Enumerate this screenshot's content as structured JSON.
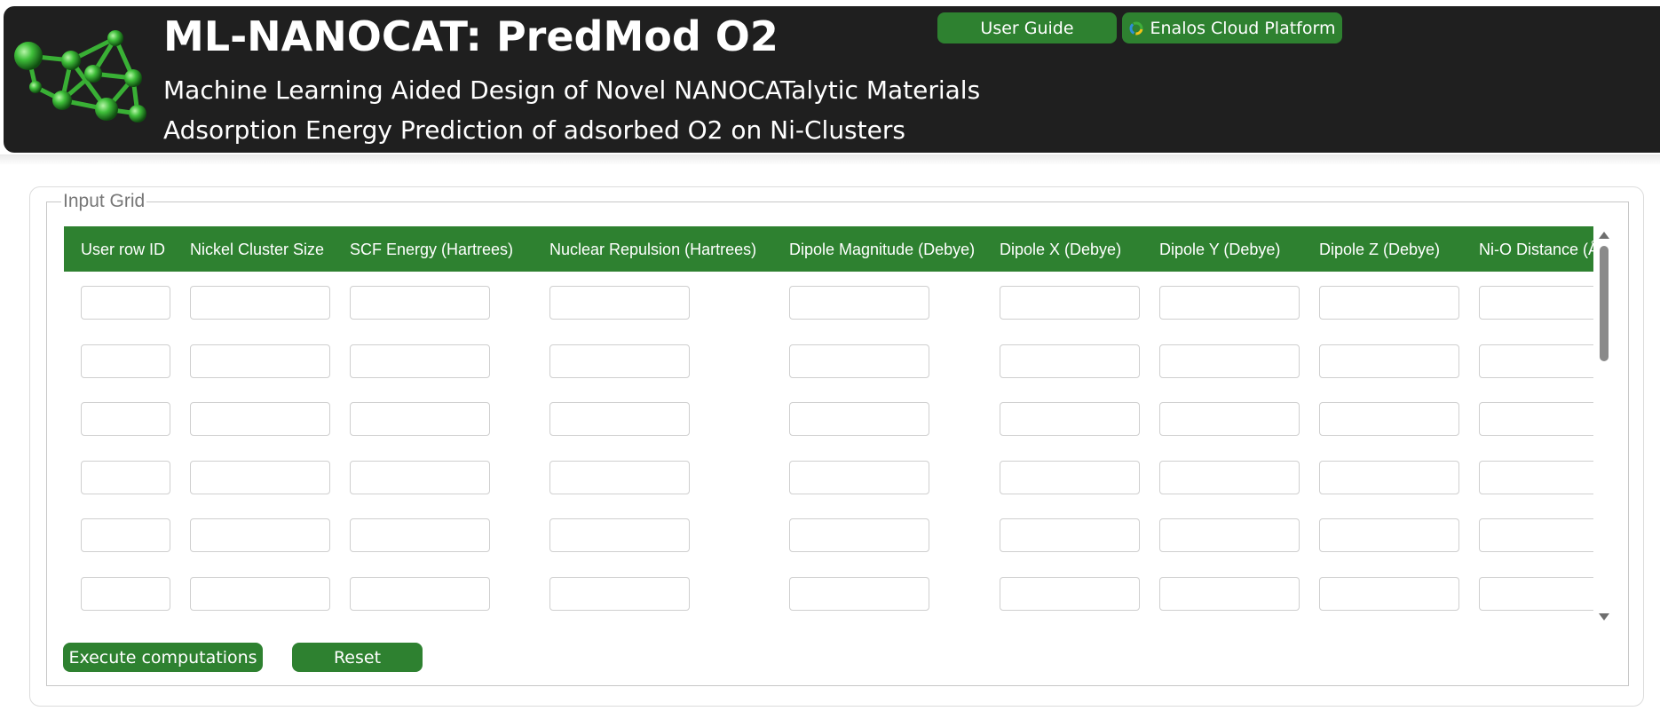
{
  "header": {
    "title": "ML-NANOCAT: PredMod O2",
    "subtitle": "Machine Learning Aided Design of Novel NANOCATalytic Materials",
    "subtitle2": "Adsorption Energy Prediction of adsorbed O2 on Ni-Clusters",
    "buttons": {
      "user_guide": "User Guide",
      "enalos": "Enalos Cloud Platform"
    },
    "logo_icon": "molecule-cluster-icon",
    "enalos_icon": "enalos-logo-icon"
  },
  "grid": {
    "legend": "Input Grid",
    "columns": [
      "User row ID",
      "Nickel Cluster Size",
      "SCF Energy (Hartrees)",
      "Nuclear Repulsion (Hartrees)",
      "Dipole Magnitude (Debye)",
      "Dipole X (Debye)",
      "Dipole Y (Debye)",
      "Dipole Z (Debye)",
      "Ni-O Distance (Å)"
    ],
    "rows": [
      [
        "",
        "",
        "",
        "",
        "",
        "",
        "",
        "",
        ""
      ],
      [
        "",
        "",
        "",
        "",
        "",
        "",
        "",
        "",
        ""
      ],
      [
        "",
        "",
        "",
        "",
        "",
        "",
        "",
        "",
        ""
      ],
      [
        "",
        "",
        "",
        "",
        "",
        "",
        "",
        "",
        ""
      ],
      [
        "",
        "",
        "",
        "",
        "",
        "",
        "",
        "",
        ""
      ],
      [
        "",
        "",
        "",
        "",
        "",
        "",
        "",
        "",
        ""
      ]
    ]
  },
  "actions": {
    "execute": "Execute computations",
    "reset": "Reset"
  },
  "colors": {
    "accent": "#2e8130",
    "header_bg": "#1f1f1f"
  }
}
